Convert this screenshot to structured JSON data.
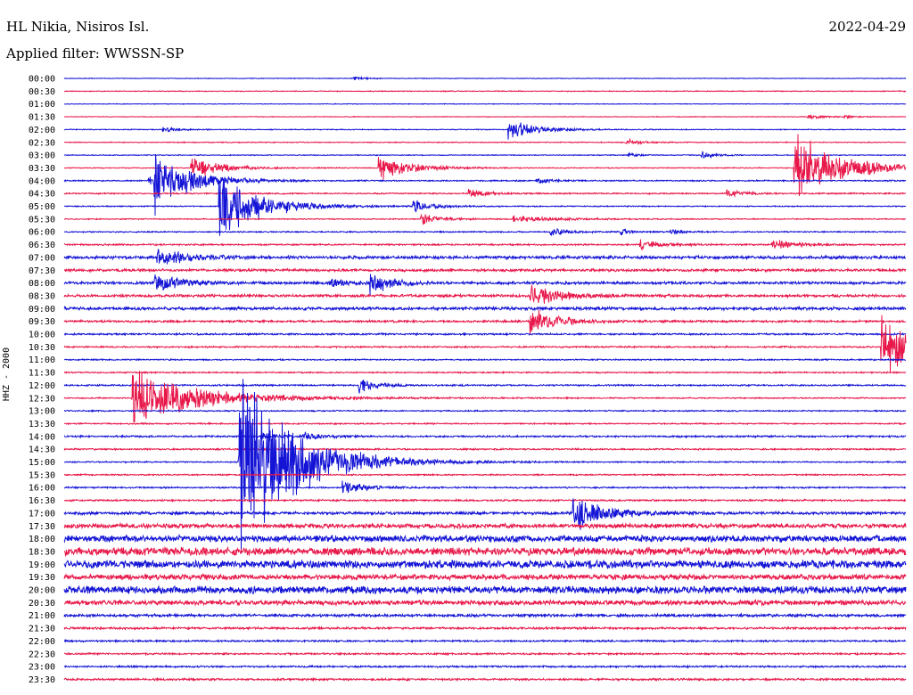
{
  "header": {
    "station": "HL Nikia, Nisiros Isl.",
    "date": "2022-04-29",
    "filter": "Applied filter: WWSSN-SP"
  },
  "channel_label": "HHZ - 2000",
  "colors": {
    "blue": "#1414d6",
    "red": "#e8184a"
  },
  "chart_data": {
    "type": "line",
    "title": "",
    "ylabel": "HHZ - 2000",
    "row_labels": [
      "00:00",
      "00:30",
      "01:00",
      "01:30",
      "02:00",
      "02:30",
      "03:00",
      "03:30",
      "04:00",
      "04:30",
      "05:00",
      "05:30",
      "06:00",
      "06:30",
      "07:00",
      "07:30",
      "08:00",
      "08:30",
      "09:00",
      "09:30",
      "10:00",
      "10:30",
      "11:00",
      "11:30",
      "12:00",
      "12:30",
      "13:00",
      "13:30",
      "14:00",
      "14:30",
      "15:00",
      "15:30",
      "16:00",
      "16:30",
      "17:00",
      "17:30",
      "18:00",
      "18:30",
      "19:00",
      "19:30",
      "20:00",
      "20:30",
      "21:00",
      "21:30",
      "22:00",
      "22:30",
      "23:00",
      "23:30"
    ],
    "row_colors": [
      "blue",
      "red"
    ],
    "noise_levels": [
      0.3,
      0.4,
      0.3,
      0.3,
      0.4,
      0.4,
      0.4,
      0.4,
      0.6,
      0.6,
      0.5,
      0.5,
      0.6,
      0.7,
      1.4,
      1.2,
      1.2,
      1.2,
      1.4,
      1.0,
      0.8,
      0.7,
      0.6,
      0.6,
      0.7,
      0.6,
      0.6,
      0.6,
      0.8,
      0.7,
      0.6,
      0.6,
      0.7,
      0.8,
      1.3,
      2.0,
      3.0,
      3.6,
      3.6,
      2.4,
      3.4,
      2.2,
      1.3,
      1.0,
      0.8,
      0.8,
      0.8,
      0.9
    ],
    "events": [
      {
        "row": 0,
        "minute": 10.3,
        "amp": 3,
        "dur": 0.6
      },
      {
        "row": 3,
        "minute": 26.5,
        "amp": 3,
        "dur": 1.0
      },
      {
        "row": 3,
        "minute": 27.8,
        "amp": 2,
        "dur": 0.6
      },
      {
        "row": 4,
        "minute": 3.5,
        "amp": 4,
        "dur": 0.8
      },
      {
        "row": 4,
        "minute": 15.8,
        "amp": 14,
        "dur": 1.6
      },
      {
        "row": 5,
        "minute": 20.0,
        "amp": 4,
        "dur": 1.0
      },
      {
        "row": 6,
        "minute": 22.7,
        "amp": 5,
        "dur": 0.8
      },
      {
        "row": 6,
        "minute": 20.1,
        "amp": 3,
        "dur": 0.6
      },
      {
        "row": 7,
        "minute": 4.5,
        "amp": 16,
        "dur": 1.6
      },
      {
        "row": 7,
        "minute": 11.2,
        "amp": 16,
        "dur": 1.8
      },
      {
        "row": 7,
        "minute": 26.0,
        "amp": 45,
        "dur": 2.6
      },
      {
        "row": 8,
        "minute": 3.0,
        "amp": 8,
        "dur": 1.0
      },
      {
        "row": 8,
        "minute": 16.8,
        "amp": 4,
        "dur": 0.8
      },
      {
        "row": 8,
        "minute": 3.2,
        "amp": 40,
        "dur": 2.0
      },
      {
        "row": 9,
        "minute": 14.4,
        "amp": 6,
        "dur": 1.0
      },
      {
        "row": 9,
        "minute": 23.6,
        "amp": 5,
        "dur": 1.0
      },
      {
        "row": 10,
        "minute": 12.4,
        "amp": 10,
        "dur": 1.0
      },
      {
        "row": 10,
        "minute": 5.5,
        "amp": 40,
        "dur": 2.4
      },
      {
        "row": 11,
        "minute": 12.7,
        "amp": 8,
        "dur": 1.0
      },
      {
        "row": 11,
        "minute": 16.0,
        "amp": 4,
        "dur": 2.4
      },
      {
        "row": 12,
        "minute": 17.3,
        "amp": 5,
        "dur": 1.0
      },
      {
        "row": 12,
        "minute": 19.8,
        "amp": 4,
        "dur": 0.6
      },
      {
        "row": 12,
        "minute": 21.6,
        "amp": 4,
        "dur": 0.6
      },
      {
        "row": 13,
        "minute": 20.5,
        "amp": 6,
        "dur": 1.2
      },
      {
        "row": 13,
        "minute": 25.2,
        "amp": 8,
        "dur": 1.2
      },
      {
        "row": 14,
        "minute": 3.3,
        "amp": 12,
        "dur": 1.6
      },
      {
        "row": 16,
        "minute": 9.4,
        "amp": 5,
        "dur": 1.4
      },
      {
        "row": 16,
        "minute": 10.9,
        "amp": 18,
        "dur": 1.0
      },
      {
        "row": 16,
        "minute": 3.2,
        "amp": 12,
        "dur": 1.6
      },
      {
        "row": 17,
        "minute": 16.6,
        "amp": 16,
        "dur": 1.6
      },
      {
        "row": 19,
        "minute": 16.6,
        "amp": 20,
        "dur": 1.4
      },
      {
        "row": 21,
        "minute": 29.1,
        "amp": 45,
        "dur": 2.0
      },
      {
        "row": 24,
        "minute": 10.5,
        "amp": 10,
        "dur": 1.0
      },
      {
        "row": 25,
        "minute": 2.4,
        "amp": 40,
        "dur": 3.6
      },
      {
        "row": 28,
        "minute": 7.0,
        "amp": 5,
        "dur": 1.0
      },
      {
        "row": 28,
        "minute": 8.5,
        "amp": 5,
        "dur": 1.2
      },
      {
        "row": 30,
        "minute": 6.2,
        "amp": 130,
        "dur": 3.0
      },
      {
        "row": 32,
        "minute": 9.9,
        "amp": 10,
        "dur": 1.2
      },
      {
        "row": 34,
        "minute": 18.1,
        "amp": 28,
        "dur": 1.6
      }
    ]
  }
}
